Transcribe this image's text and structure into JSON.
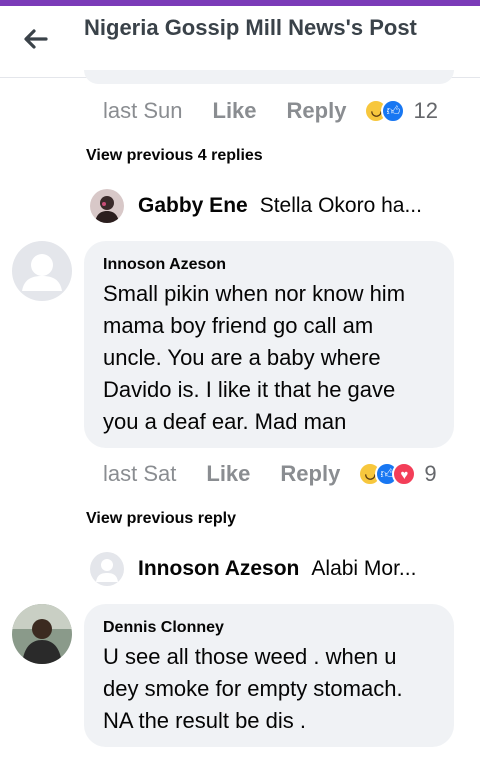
{
  "header": {
    "title": "Nigeria Gossip Mill News's Post"
  },
  "colors": {
    "accent": "#7b3bb8",
    "like": "#1877f2",
    "love": "#f33e58",
    "haha": "#f7c73d"
  },
  "thread1": {
    "time": "last Sun",
    "like": "Like",
    "reply": "Reply",
    "react_count": "12",
    "reactions": [
      "haha-icon",
      "like-icon"
    ]
  },
  "view_prev_1": "View previous 4 replies",
  "reply1": {
    "name": "Gabby Ene",
    "preview": "Stella Okoro ha..."
  },
  "comment1": {
    "name": "Innoson Azeson",
    "body": "Small pikin when nor know him mama boy friend go call am uncle. You are a baby where Davido is. I like it that he gave you a deaf ear. Mad man",
    "time": "last Sat",
    "like": "Like",
    "reply": "Reply",
    "react_count": "9",
    "reactions": [
      "haha-icon",
      "like-icon",
      "love-icon"
    ]
  },
  "view_prev_2": "View previous reply",
  "reply2": {
    "name": "Innoson Azeson",
    "preview": "Alabi Mor..."
  },
  "comment2": {
    "name": "Dennis Clonney",
    "body": "U see all those weed . when u dey smoke for empty stomach. NA the result be dis ."
  }
}
